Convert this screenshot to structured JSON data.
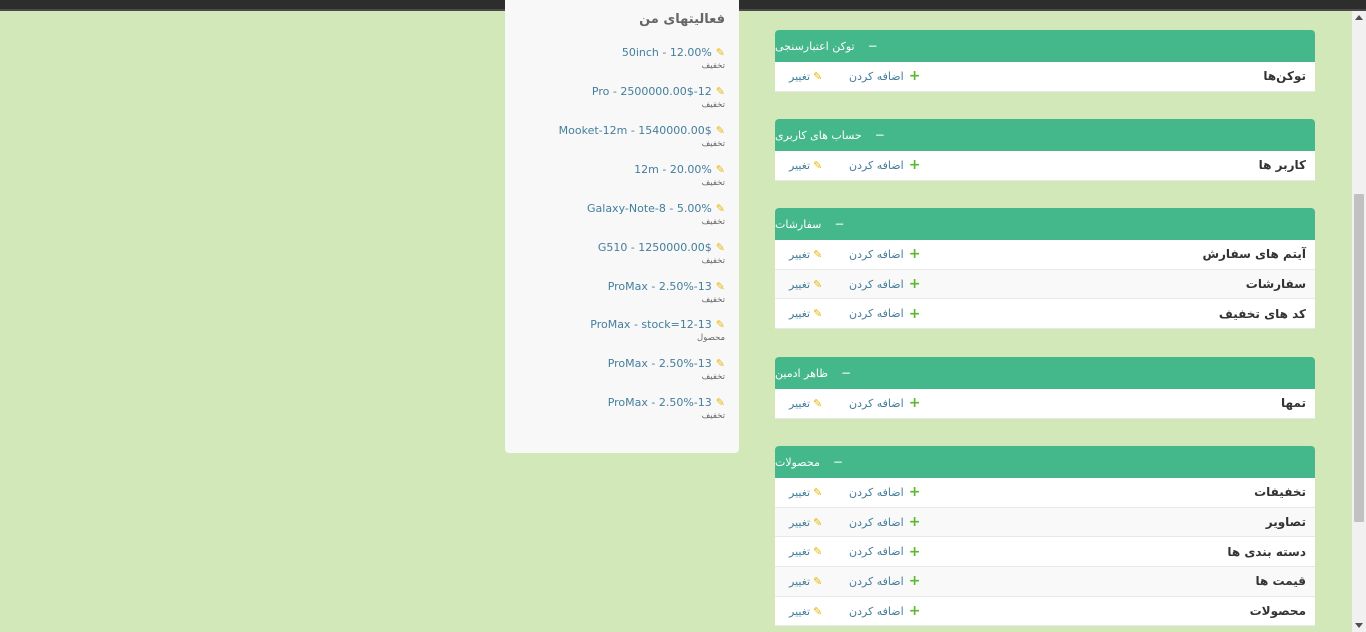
{
  "colors": {
    "page_background": "#d2e8b9",
    "module_header": "#44b78b",
    "add_icon": "#5cb82e",
    "change_icon": "#e6b800",
    "link": "#447e9b"
  },
  "icons": {
    "collapse": "minus-icon",
    "add": "plus-icon",
    "change": "pencil-icon"
  },
  "modules": [
    {
      "title": "توکن اعتبارسنجی",
      "rows": [
        {
          "name": "توکن‌ها",
          "add": "اضافه کردن",
          "change": "تغییر"
        }
      ]
    },
    {
      "title": "حساب های کاربری",
      "rows": [
        {
          "name": "کاربر ها",
          "add": "اضافه کردن",
          "change": "تغییر"
        }
      ]
    },
    {
      "title": "سفارشات",
      "rows": [
        {
          "name": "آیتم های سفارش",
          "add": "اضافه کردن",
          "change": "تغییر"
        },
        {
          "name": "سفارشات",
          "add": "اضافه کردن",
          "change": "تغییر"
        },
        {
          "name": "کد های تخفیف",
          "add": "اضافه کردن",
          "change": "تغییر"
        }
      ]
    },
    {
      "title": "ظاهر ادمین",
      "rows": [
        {
          "name": "تمها",
          "add": "اضافه کردن",
          "change": "تغییر"
        }
      ]
    },
    {
      "title": "محصولات",
      "rows": [
        {
          "name": "تخفیفات",
          "add": "اضافه کردن",
          "change": "تغییر"
        },
        {
          "name": "تصاویر",
          "add": "اضافه کردن",
          "change": "تغییر"
        },
        {
          "name": "دسته بندی ها",
          "add": "اضافه کردن",
          "change": "تغییر"
        },
        {
          "name": "قیمت ها",
          "add": "اضافه کردن",
          "change": "تغییر"
        },
        {
          "name": "محصولات",
          "add": "اضافه کردن",
          "change": "تغییر"
        }
      ]
    }
  ],
  "recent_actions": {
    "title": "فعالیتهای من",
    "items": [
      {
        "text": "50inch - 12.00%",
        "type": "تخفیف"
      },
      {
        "text": "Pro - 2500000.00$-12",
        "type": "تخفیف"
      },
      {
        "text": "Mooket-12m - 1540000.00$",
        "type": "تخفیف"
      },
      {
        "text": "12m - 20.00%",
        "type": "تخفیف"
      },
      {
        "text": "Galaxy-Note-8 - 5.00%",
        "type": "تخفیف"
      },
      {
        "text": "G510 - 1250000.00$",
        "type": "تخفیف"
      },
      {
        "text": "ProMax - 2.50%-13",
        "type": "تخفیف"
      },
      {
        "text": "ProMax - stock=12-13",
        "type": "محصول"
      },
      {
        "text": "ProMax - 2.50%-13",
        "type": "تخفیف"
      },
      {
        "text": "ProMax - 2.50%-13",
        "type": "تخفیف"
      }
    ]
  }
}
